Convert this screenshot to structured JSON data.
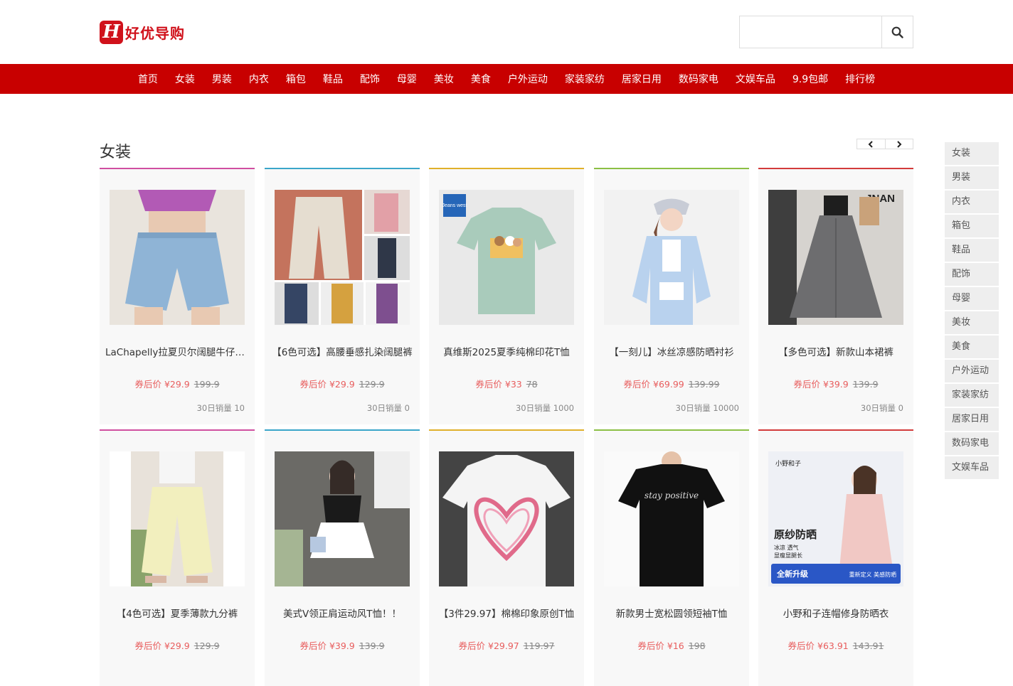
{
  "brand": {
    "logo_letter": "H",
    "name": "好优导购",
    "color": "#d0111b"
  },
  "search": {
    "value": "",
    "placeholder": "",
    "icon": "search-icon"
  },
  "nav": [
    "首页",
    "女装",
    "男装",
    "内衣",
    "箱包",
    "鞋品",
    "配饰",
    "母婴",
    "美妆",
    "美食",
    "户外运动",
    "家装家纺",
    "居家日用",
    "数码家电",
    "文娱车品",
    "9.9包邮",
    "排行榜"
  ],
  "section": {
    "title": "女装",
    "prev_icon": "chevron-left-icon",
    "next_icon": "chevron-right-icon"
  },
  "products": [
    {
      "title": "LaChapelly拉夏贝尔阔腿牛仔短裤",
      "price_label": "券后价",
      "price": "¥29.9",
      "orig": "199.9",
      "sales": "30日销量 10",
      "bar": "#d04fa0",
      "img": "denim-shorts"
    },
    {
      "title": "【6色可选】高腰垂感扎染阔腿裤",
      "price_label": "券后价",
      "price": "¥29.9",
      "orig": "129.9",
      "sales": "30日销量 0",
      "bar": "#3aa6c9",
      "img": "wide-pants"
    },
    {
      "title": "真维斯2025夏季纯棉印花T恤",
      "price_label": "券后价",
      "price": "¥33",
      "orig": "78",
      "sales": "30日销量 1000",
      "bar": "#e0b02a",
      "img": "green-tshirt"
    },
    {
      "title": "【一刻儿】冰丝凉感防晒衬衫",
      "price_label": "券后价",
      "price": "¥69.99",
      "orig": "139.99",
      "sales": "30日销量 10000",
      "bar": "#8cbf44",
      "img": "blue-shirt"
    },
    {
      "title": "【多色可选】新款山本裙裤",
      "price_label": "券后价",
      "price": "¥39.9",
      "orig": "139.9",
      "sales": "30日销量 0",
      "bar": "#d33b3b",
      "img": "grey-skirt"
    },
    {
      "title": "【4色可选】夏季薄款九分裤",
      "price_label": "券后价",
      "price": "¥29.9",
      "orig": "129.9",
      "sales": "",
      "bar": "#d04fa0",
      "img": "yellow-pants"
    },
    {
      "title": "美式V领正肩运动风T恤！！",
      "price_label": "券后价",
      "price": "¥39.9",
      "orig": "139.9",
      "sales": "",
      "bar": "#3aa6c9",
      "img": "black-top"
    },
    {
      "title": "【3件29.97】棉棉印象原创T恤",
      "price_label": "券后价",
      "price": "¥29.97",
      "orig": "119.97",
      "sales": "",
      "bar": "#e0b02a",
      "img": "heart-tshirt"
    },
    {
      "title": "新款男士宽松圆领短袖T恤",
      "price_label": "券后价",
      "price": "¥16",
      "orig": "198",
      "sales": "",
      "bar": "#8cbf44",
      "img": "black-tshirt"
    },
    {
      "title": "小野和子连帽修身防晒衣",
      "price_label": "券后价",
      "price": "¥63.91",
      "orig": "143.91",
      "sales": "",
      "bar": "#d33b3b",
      "img": "sun-jacket"
    }
  ],
  "image_text": {
    "jnan": "JNAN",
    "jeanswest": "Jeans west",
    "ono_brand": "小野和子",
    "ono_head": "原纱防晒",
    "ono_sub1": "冰凉 透气",
    "ono_sub2": "显瘦显腿长",
    "ono_badge": "全新升级",
    "ono_tag": "重新定义 美感防晒",
    "script": "stay positive"
  },
  "sidebar": [
    "女装",
    "男装",
    "内衣",
    "箱包",
    "鞋品",
    "配饰",
    "母婴",
    "美妆",
    "美食",
    "户外运动",
    "家装家纺",
    "居家日用",
    "数码家电",
    "文娱车品"
  ]
}
